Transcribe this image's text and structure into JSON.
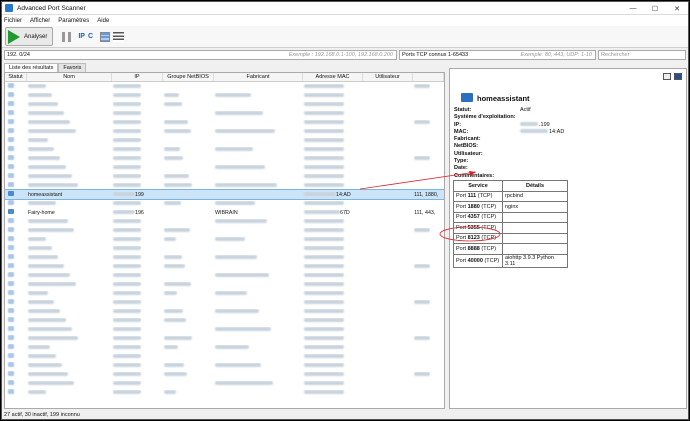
{
  "window": {
    "title": "Advanced Port Scanner"
  },
  "menu": [
    "Fichier",
    "Afficher",
    "Paramètres",
    "Aide"
  ],
  "toolbar": {
    "scan_label": "Analyser",
    "ip_label": "IP",
    "c_label": "C"
  },
  "inputs": {
    "ip_range": "192.        0/24",
    "ip_example": "Exemple : 192.168.0.1-100, 192.168.0.200",
    "ports": "Ports TCP connus 1-65433",
    "ports_example": "Exemple: 80, 443, UDP: 1-10",
    "search_placeholder": "Rechercher"
  },
  "tabs": [
    "Liste des résultats",
    "Favoris"
  ],
  "columns": [
    "Statut",
    "Nom",
    "IP",
    "Groupe NetBIOS",
    "Fabricant",
    "Adresse MAC",
    "Utilisateur"
  ],
  "selected_row": {
    "name": "homeassistant",
    "ip_tail": "199",
    "mac_tail": "14:AD",
    "ports": "111, 1880,"
  },
  "fairy_row": {
    "name": "Fairy-home",
    "ip_tail": "196",
    "netbios": "WIBRAIN",
    "mac_tail": "67D",
    "ports": "111, 443,"
  },
  "status_bar": "27 actif, 30 inactif, 199 inconnu",
  "details": {
    "title": "homeassistant",
    "fields": [
      {
        "key": "Statut:",
        "value": "Actif"
      },
      {
        "key": "Système d'exploitation:",
        "value": ""
      },
      {
        "key": "IP:",
        "value": ".199"
      },
      {
        "key": "MAC:",
        "value": "14:AD"
      },
      {
        "key": "Fabricant:",
        "value": ""
      },
      {
        "key": "NetBIOS:",
        "value": ""
      },
      {
        "key": "Utilisateur:",
        "value": ""
      },
      {
        "key": "Type:",
        "value": ""
      },
      {
        "key": "Date:",
        "value": ""
      },
      {
        "key": "Commentaires:",
        "value": ""
      }
    ],
    "ports_header": [
      "Service",
      "Détails"
    ],
    "ports": [
      {
        "prefix": "Port ",
        "num": "111",
        "proto": " (TCP)",
        "detail": "rpcbind"
      },
      {
        "prefix": "Port ",
        "num": "1880",
        "proto": " (TCP)",
        "detail": "nginx"
      },
      {
        "prefix": "Port ",
        "num": "4357",
        "proto": " (TCP)",
        "detail": ""
      },
      {
        "prefix": "Port ",
        "num": "5355",
        "proto": " (TCP)",
        "detail": ""
      },
      {
        "prefix": "Port ",
        "num": "8123",
        "proto": " (TCP)",
        "detail": ""
      },
      {
        "prefix": "Port ",
        "num": "8888",
        "proto": " (TCP)",
        "detail": ""
      },
      {
        "prefix": "Port ",
        "num": "40000",
        "proto": " (TCP)",
        "detail": "aiohttp 3.9.3 Python 3.11"
      }
    ]
  },
  "colors": {
    "selection": "#cce4f7",
    "annotation": "#d9232a",
    "play": "#1f9a30"
  }
}
